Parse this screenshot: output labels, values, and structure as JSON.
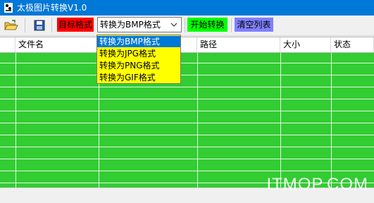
{
  "window": {
    "title": "太极图片转换V1.0"
  },
  "toolbar": {
    "target_label": "目标格式",
    "format_value": "转换为BMP格式",
    "start_button": "开始转换",
    "clear_button": "清空列表"
  },
  "dropdown": {
    "options": [
      "转换为BMP格式",
      "转换为JPG格式",
      "转换为PNG格式",
      "转换为GIF格式"
    ]
  },
  "table": {
    "columns": [
      "文件名",
      "路径",
      "大小",
      "状态"
    ]
  },
  "watermark": "ITMOP.COM",
  "colors": {
    "title_bar": "#0078d7",
    "grid": "#33cc33",
    "target_label": "#ff0000",
    "start_button": "#00ff00",
    "clear_button": "#8080ff",
    "dropdown_bg": "#ffff00",
    "selected_option": "#0078d7"
  },
  "icons": [
    "app-icon",
    "open-folder-icon",
    "save-icon",
    "chevron-down-icon"
  ]
}
